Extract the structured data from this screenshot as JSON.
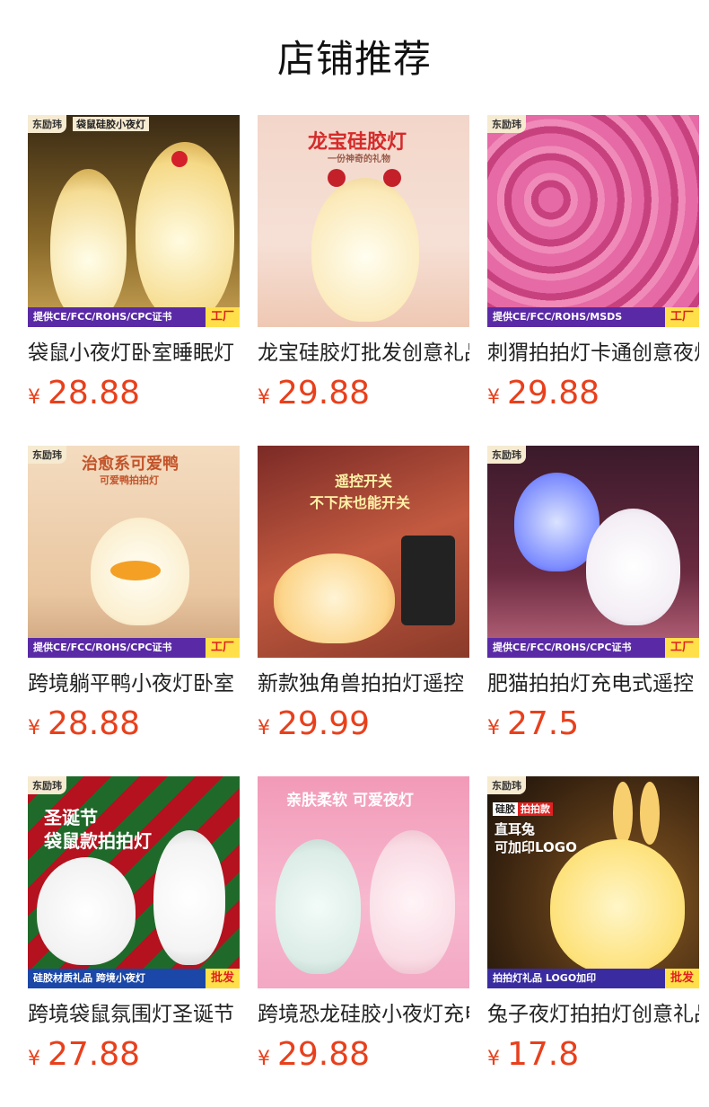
{
  "page_title": "店铺推荐",
  "products": [
    {
      "name": "袋鼠小夜灯卧室睡眠灯",
      "currency": "¥",
      "price": "28.88",
      "brand": "东励玮",
      "headline": "袋鼠硅胶小夜灯",
      "cert": "提供CE/FCC/ROHS/CPC证书",
      "tag": "工厂",
      "icon": "kangaroo-lamp-icon"
    },
    {
      "name": "龙宝硅胶灯批发创意礼品",
      "currency": "¥",
      "price": "29.88",
      "brand": "",
      "headline": "龙宝硅胶灯",
      "subline": "一份神奇的礼物",
      "cert": "",
      "tag": "",
      "icon": "dragon-lamp-icon"
    },
    {
      "name": "刺猬拍拍灯卡通创意夜灯",
      "currency": "¥",
      "price": "29.88",
      "brand": "东励玮",
      "headline": "",
      "cert": "提供CE/FCC/ROHS/MSDS",
      "tag": "工厂",
      "icon": "hedgehog-lamp-icon"
    },
    {
      "name": "跨境躺平鸭小夜灯卧室",
      "currency": "¥",
      "price": "28.88",
      "brand": "东励玮",
      "headline": "治愈系可爱鸭",
      "subline": "可爱鸭拍拍灯",
      "cert": "提供CE/FCC/ROHS/CPC证书",
      "tag": "工厂",
      "icon": "duck-lamp-icon"
    },
    {
      "name": "新款独角兽拍拍灯遥控",
      "currency": "¥",
      "price": "29.99",
      "brand": "",
      "headline": "遥控开关",
      "subline": "不下床也能开关",
      "cert": "",
      "tag": "",
      "icon": "unicorn-lamp-icon"
    },
    {
      "name": "肥猫拍拍灯充电式遥控",
      "currency": "¥",
      "price": "27.5",
      "brand": "东励玮",
      "headline": "",
      "cert": "提供CE/FCC/ROHS/CPC证书",
      "tag": "工厂",
      "icon": "cat-lamp-icon"
    },
    {
      "name": "跨境袋鼠氛围灯圣诞节",
      "currency": "¥",
      "price": "27.88",
      "brand": "东励玮",
      "headline": "圣诞节",
      "subline": "袋鼠款拍拍灯",
      "cert": "硅胶材质礼品 跨境小夜灯",
      "tag": "批发",
      "icon": "christmas-lamp-icon"
    },
    {
      "name": "跨境恐龙硅胶小夜灯充电",
      "currency": "¥",
      "price": "29.88",
      "brand": "",
      "headline": "亲肤柔软 可爱夜灯",
      "cert": "",
      "tag": "",
      "icon": "dinosaur-lamp-icon"
    },
    {
      "name": "兔子夜灯拍拍灯创意礼品",
      "currency": "¥",
      "price": "17.8",
      "brand": "东励玮",
      "headline": "直耳兔",
      "subline": "可加印LOGO",
      "badge": "硅胶",
      "badge2": "拍拍款",
      "cert": "拍拍灯礼品  LOGO加印",
      "tag": "批发",
      "icon": "rabbit-lamp-icon"
    }
  ]
}
